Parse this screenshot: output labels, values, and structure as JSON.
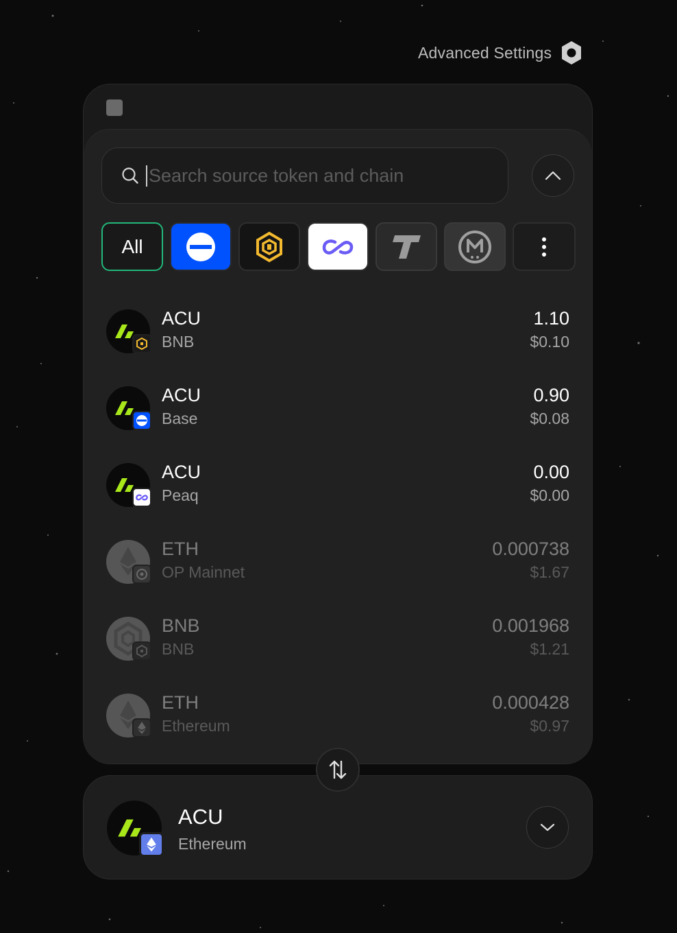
{
  "header": {
    "advanced_settings_label": "Advanced Settings",
    "settings_icon": "hexagon-gear-icon"
  },
  "search": {
    "placeholder": "Search source token and chain",
    "value": ""
  },
  "chain_filters": [
    {
      "id": "all",
      "label": "All",
      "selected": true
    },
    {
      "id": "base",
      "icon": "base-chain-icon"
    },
    {
      "id": "bnb",
      "icon": "bnb-chain-icon"
    },
    {
      "id": "peaq",
      "icon": "peaq-chain-icon"
    },
    {
      "id": "t",
      "icon": "t-chain-icon"
    },
    {
      "id": "m",
      "icon": "m-chain-icon"
    },
    {
      "id": "more",
      "icon": "more-vertical-icon"
    }
  ],
  "tokens": [
    {
      "symbol": "ACU",
      "chain": "BNB",
      "balance": "1.10",
      "usd": "$0.10",
      "dimmed": false
    },
    {
      "symbol": "ACU",
      "chain": "Base",
      "balance": "0.90",
      "usd": "$0.08",
      "dimmed": false
    },
    {
      "symbol": "ACU",
      "chain": "Peaq",
      "balance": "0.00",
      "usd": "$0.00",
      "dimmed": false
    },
    {
      "symbol": "ETH",
      "chain": "OP Mainnet",
      "balance": "0.000738",
      "usd": "$1.67",
      "dimmed": true
    },
    {
      "symbol": "BNB",
      "chain": "BNB",
      "balance": "0.001968",
      "usd": "$1.21",
      "dimmed": true
    },
    {
      "symbol": "ETH",
      "chain": "Ethereum",
      "balance": "0.000428",
      "usd": "$0.97",
      "dimmed": true
    }
  ],
  "destination": {
    "symbol": "ACU",
    "chain": "Ethereum"
  },
  "colors": {
    "accent_green": "#22b87a",
    "acu_lime": "#a8e81a",
    "base_blue": "#0052ff",
    "bnb_yellow": "#f3ba2f",
    "peaq_purple": "#6b5cf6",
    "eth_purple": "#627eea"
  }
}
